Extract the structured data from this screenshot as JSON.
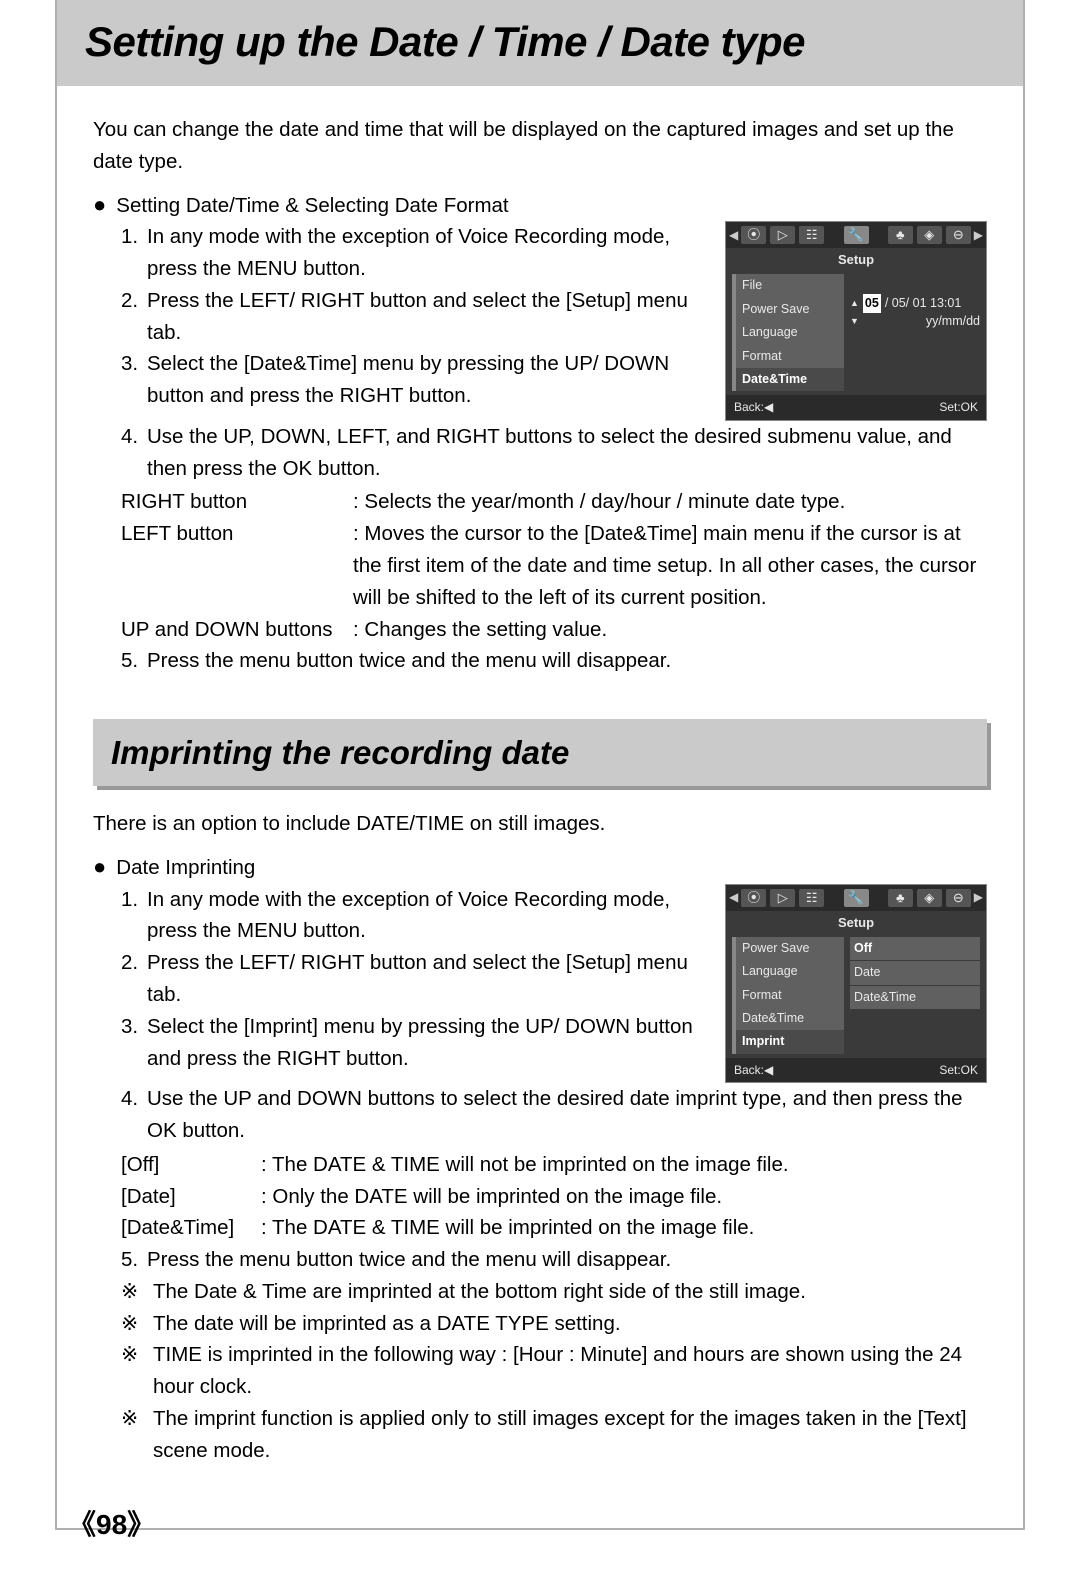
{
  "page": {
    "title": "Setting up the Date / Time / Date type",
    "section2_title": "Imprinting the recording date",
    "page_number": "《98》"
  },
  "section1": {
    "intro": "You can change the date and time that will be displayed on the captured images and set up the date type.",
    "bullet_heading": "Setting Date/Time & Selecting Date Format",
    "steps": {
      "s1_num": "1.",
      "s1": "In any mode with the exception of Voice Recording mode, press the MENU button.",
      "s2_num": "2.",
      "s2": "Press the LEFT/ RIGHT button and select the [Setup] menu tab.",
      "s3_num": "3.",
      "s3": "Select the [Date&Time] menu by pressing the UP/ DOWN button and press the RIGHT button.",
      "s4_num": "4.",
      "s4": "Use the UP, DOWN, LEFT, and RIGHT buttons to select the desired submenu value, and then press the OK button.",
      "right_label": "RIGHT button",
      "right_text": ": Selects the year/month / day/hour / minute date type.",
      "left_label": "LEFT button",
      "left_text": ": Moves the cursor to the [Date&Time] main menu if the cursor is at the first item of the date and time setup. In all other cases, the cursor will be shifted to the left of its current position.",
      "updown_label": "UP and DOWN buttons",
      "updown_text": ": Changes the setting value.",
      "s5_num": "5.",
      "s5": "Press the menu button twice and the menu will disappear."
    }
  },
  "section2": {
    "intro": "There is an option to include DATE/TIME on still images.",
    "bullet_heading": "Date Imprinting",
    "steps": {
      "s1_num": "1.",
      "s1": "In any mode with the exception of Voice Recording mode, press the MENU button.",
      "s2_num": "2.",
      "s2": "Press the LEFT/ RIGHT button and select the [Setup] menu tab.",
      "s3_num": "3.",
      "s3": "Select the [Imprint] menu by pressing the UP/ DOWN button and press the RIGHT button.",
      "s4_num": "4.",
      "s4": "Use the UP and DOWN buttons to select the desired date imprint type, and then press the OK button.",
      "off_label": "[Off]",
      "off_text": ": The DATE & TIME will not be imprinted on the image file.",
      "date_label": "[Date]",
      "date_text": ": Only the DATE will be imprinted on the image file.",
      "dt_label": "[Date&Time]",
      "dt_text": ": The DATE & TIME will be imprinted on the image file.",
      "s5_num": "5.",
      "s5": "Press the menu button twice and the menu will disappear.",
      "note_sym": "※",
      "note1": "The Date & Time are imprinted at the bottom right side of the still image.",
      "note2": "The date will be imprinted as a DATE TYPE setting.",
      "note3": "TIME is imprinted in the following way : [Hour : Minute] and hours are shown using the 24 hour clock.",
      "note4": "The imprint function is applied only to still images except for the images taken in the [Text] scene mode."
    }
  },
  "lcd1": {
    "setup_label": "Setup",
    "items": [
      "File",
      "Power Save",
      "Language",
      "Format",
      "Date&Time"
    ],
    "date_hl": "05",
    "date_rest": "/ 05/ 01 13:01",
    "date_format": "yy/mm/dd",
    "back": "Back:◀",
    "set": "Set:OK"
  },
  "lcd2": {
    "setup_label": "Setup",
    "items": [
      "Power Save",
      "Language",
      "Format",
      "Date&Time",
      "Imprint"
    ],
    "options": [
      "Off",
      "Date",
      "Date&Time"
    ],
    "back": "Back:◀",
    "set": "Set:OK"
  }
}
